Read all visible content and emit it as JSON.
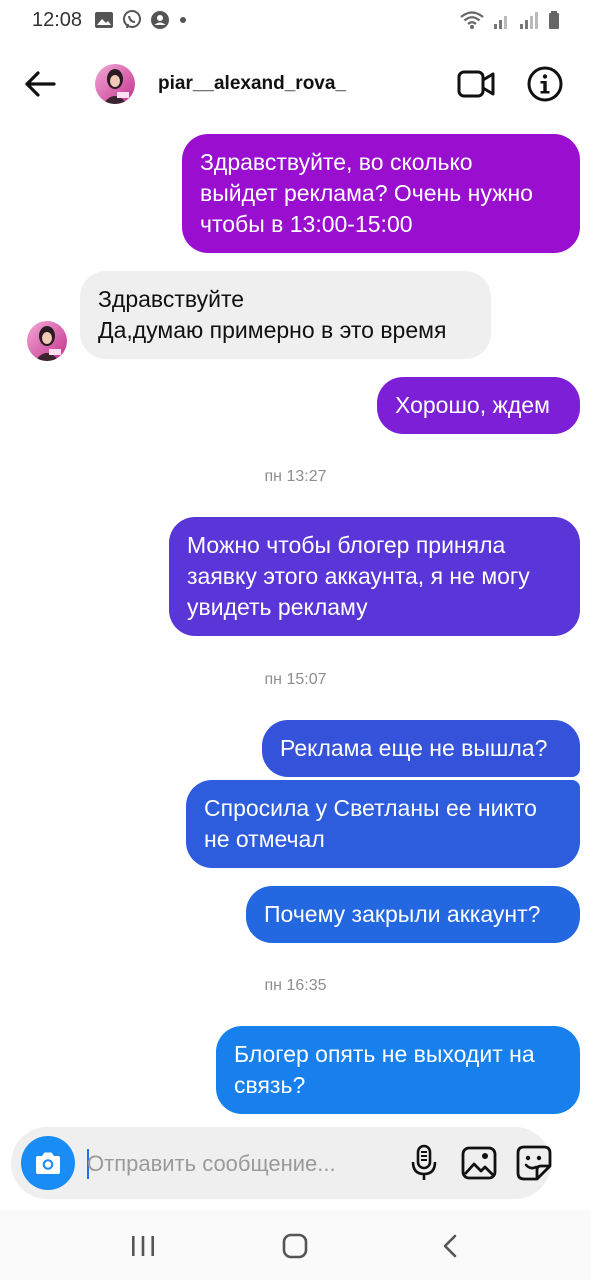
{
  "status_bar": {
    "time": "12:08",
    "left_icons": [
      "image-icon",
      "viber-icon",
      "account-circle-icon",
      "dot-icon"
    ],
    "right_icons": [
      "wifi-icon",
      "signal-icon",
      "signal-r-icon",
      "battery-icon"
    ]
  },
  "header": {
    "username": "piar__alexand_rova_"
  },
  "messages": [
    {
      "direction": "out",
      "text": "Здравствуйте, во сколько\nвыйдет реклама? Очень нужно\nчтобы в 13:00-15:00",
      "color": "#9a0fcf"
    },
    {
      "direction": "in",
      "text": "Здравствуйте\nДа,думаю примерно в это время",
      "color": "#efefef"
    },
    {
      "direction": "out",
      "text": "Хорошо, ждем",
      "color": "#7c1fd6"
    },
    {
      "direction": "out",
      "text": "Можно чтобы блогер приняла\nзаявку этого аккаунта, я не могу\nувидеть рекламу",
      "color": "#5a35d8"
    },
    {
      "direction": "out",
      "text": "Реклама еще не вышла?",
      "color": "#3552da"
    },
    {
      "direction": "out",
      "text": "Спросила у Светланы ее никто\nне отмечал",
      "color": "#2d5ddd"
    },
    {
      "direction": "out",
      "text": "Почему закрыли аккаунт?",
      "color": "#2367e1"
    },
    {
      "direction": "out",
      "text": "Блогер опять не выходит на\nсвязь?",
      "color": "#1780ec"
    }
  ],
  "timestamps": [
    "пн 13:27",
    "пн 15:07",
    "пн 16:35"
  ],
  "composer": {
    "placeholder": "Отправить сообщение...",
    "value": ""
  },
  "colors": {
    "accent_blue": "#1a8cf5",
    "incoming_bubble": "#efefef",
    "timestamp": "#8e8e8e"
  }
}
